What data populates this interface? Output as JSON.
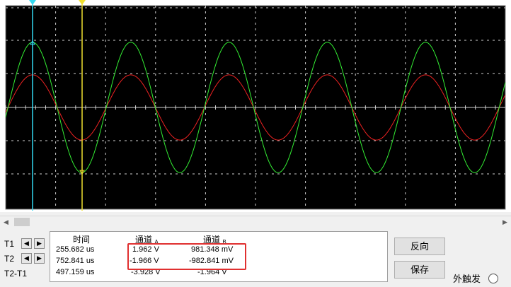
{
  "scope": {
    "colors": {
      "background": "#000000",
      "grid": "#d0d0d0",
      "channel_a": "#33ee33",
      "channel_b": "#ee2222",
      "cursor_t1": "#33d8f0",
      "cursor_t2": "#f0e030"
    },
    "channel_a_amplitude_v": 1.962,
    "channel_b_amplitude_v": 0.981,
    "cycles_visible": 5
  },
  "cursors": [
    {
      "label": "T1",
      "left_icon": "left-arrow-icon",
      "right_icon": "right-arrow-icon"
    },
    {
      "label": "T2",
      "left_icon": "left-arrow-icon",
      "right_icon": "right-arrow-icon"
    },
    {
      "label": "T2-T1"
    }
  ],
  "table": {
    "header_time": "时间",
    "header_ch_a": "通道",
    "header_ch_a_sub": "A",
    "header_ch_b": "通道",
    "header_ch_b_sub": "B",
    "rows": [
      {
        "time": "255.682 us",
        "a": "1.962 V",
        "b": "981.348 mV"
      },
      {
        "time": "752.841 us",
        "a": "-1.966 V",
        "b": "-982.841 mV"
      },
      {
        "time": "497.159 us",
        "a": "-3.928 V",
        "b": "-1.964 V"
      }
    ]
  },
  "buttons": {
    "invert": "反向",
    "save": "保存"
  },
  "external_trigger": {
    "label": "外触发",
    "checked": false
  }
}
